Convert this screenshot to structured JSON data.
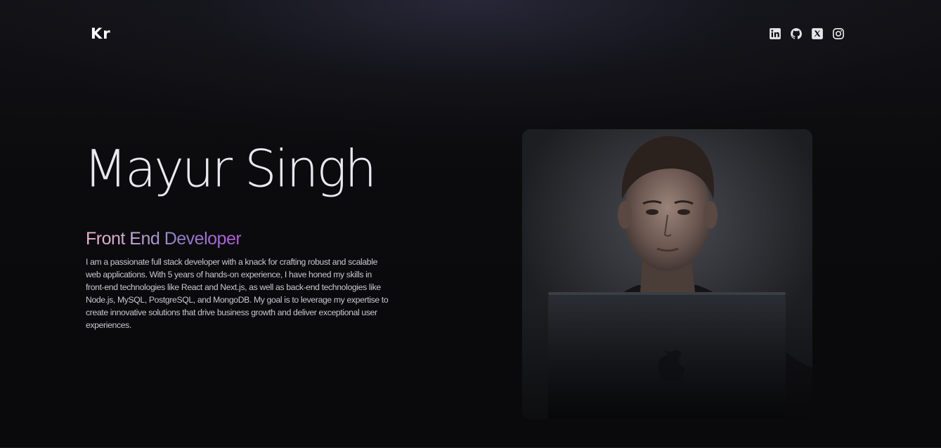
{
  "header": {
    "logo": "Kr",
    "social_icons": [
      "linkedin-icon",
      "github-icon",
      "x-twitter-icon",
      "instagram-icon"
    ]
  },
  "hero": {
    "name": "Mayur Singh",
    "role": "Front End Developer",
    "bio": "I am a passionate full stack developer with a knack for crafting robust and scalable web applications. With 5 years of hands-on experience, I have honed my skills in front-end technologies like React and Next.js, as well as back-end technologies like Node.js, MySQL, PostgreSQL, and MongoDB. My goal is to leverage my expertise to create innovative solutions that drive business growth and deliver exceptional user experiences."
  },
  "colors": {
    "background": "#0c0c0e",
    "role_gradient": [
      "#f2b4cf",
      "#8f7fc8",
      "#b25bd9"
    ],
    "text_primary": "#e9e9ee",
    "text_secondary": "#c9c9cf"
  }
}
